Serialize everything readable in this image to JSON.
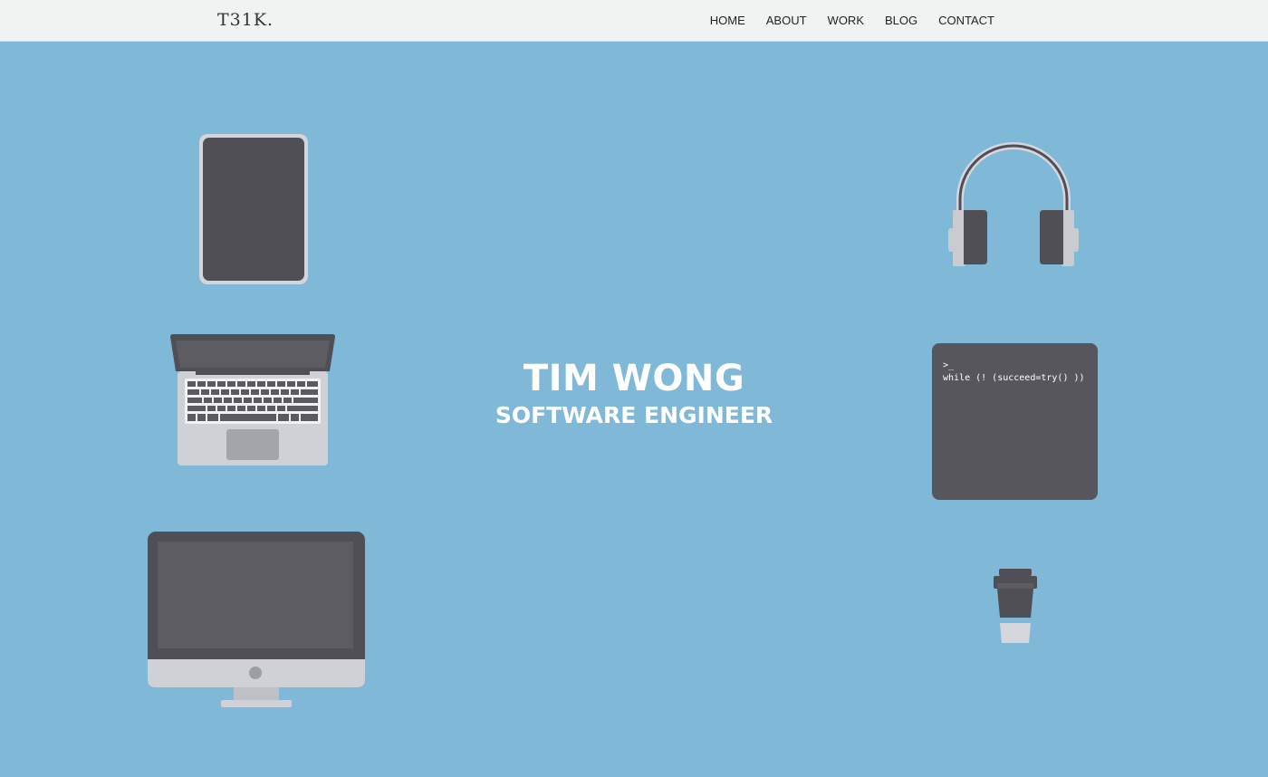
{
  "header": {
    "logo": "T31K.",
    "nav": [
      {
        "label": "HOME"
      },
      {
        "label": "ABOUT"
      },
      {
        "label": "WORK"
      },
      {
        "label": "BLOG"
      },
      {
        "label": "CONTACT"
      }
    ]
  },
  "hero": {
    "name": "TIM WONG",
    "title": "SOFTWARE ENGINEER"
  },
  "terminal": {
    "prompt": ">_",
    "code": "while (! (succeed=try() ))"
  },
  "icons": [
    "tablet-icon",
    "laptop-icon",
    "desktop-monitor-icon",
    "headphones-icon",
    "terminal-icon",
    "coffee-cup-icon"
  ],
  "colors": {
    "background": "#80b9d8",
    "navbar": "#f1f3f3",
    "device_dark": "#56565c",
    "device_light": "#c9cbd0"
  }
}
